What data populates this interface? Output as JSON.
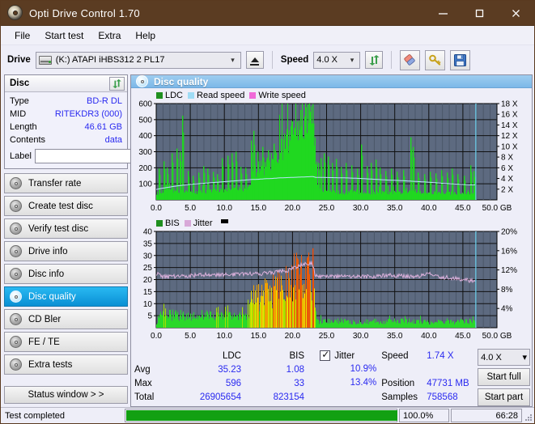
{
  "window": {
    "title": "Opti Drive Control 1.70",
    "icon": "disc-icon",
    "minimize": "–",
    "maximize": "□",
    "close": "✕"
  },
  "menu": {
    "items": [
      "File",
      "Start test",
      "Extra",
      "Help"
    ]
  },
  "toolbar": {
    "drive_label": "Drive",
    "drive_value": "(K:)  ATAPI iHBS312   2 PL17",
    "eject_title": "eject",
    "speed_label": "Speed",
    "speed_value": "4.0 X",
    "refresh_icon": "refresh-icon",
    "erase_icon": "eraser-icon",
    "tools_icon": "keys-icon",
    "save_icon": "floppy-save-icon"
  },
  "disc": {
    "group_title": "Disc",
    "refresh_icon": "refresh-icon",
    "rows": [
      {
        "key": "Type",
        "value": "BD-R DL"
      },
      {
        "key": "MID",
        "value": "RITEKDR3 (000)"
      },
      {
        "key": "Length",
        "value": "46.61 GB"
      },
      {
        "key": "Contents",
        "value": "data"
      }
    ],
    "label_key": "Label",
    "label_value": "",
    "label_placeholder": ""
  },
  "sidebar": {
    "items": [
      {
        "label": "Transfer rate",
        "active": false
      },
      {
        "label": "Create test disc",
        "active": false
      },
      {
        "label": "Verify test disc",
        "active": false
      },
      {
        "label": "Drive info",
        "active": false
      },
      {
        "label": "Disc info",
        "active": false
      },
      {
        "label": "Disc quality",
        "active": true
      },
      {
        "label": "CD Bler",
        "active": false
      },
      {
        "label": "FE / TE",
        "active": false
      },
      {
        "label": "Extra tests",
        "active": false
      }
    ],
    "status_button": "Status window > >"
  },
  "panel": {
    "title": "Disc quality",
    "icon": "disc-quality-icon"
  },
  "stats": {
    "col_ldc": "LDC",
    "col_bis": "BIS",
    "jitter_label": "Jitter",
    "jitter_checked": true,
    "rows": [
      {
        "label": "Avg",
        "ldc": "35.23",
        "bis": "1.08",
        "jitter": "10.9%"
      },
      {
        "label": "Max",
        "ldc": "596",
        "bis": "33",
        "jitter": "13.4%"
      },
      {
        "label": "Total",
        "ldc": "26905654",
        "bis": "823154",
        "jitter": ""
      }
    ],
    "speed_label": "Speed",
    "speed_value": "1.74 X",
    "position_label": "Position",
    "position_value": "47731 MB",
    "samples_label": "Samples",
    "samples_value": "758568",
    "speed_select": "4.0 X",
    "start_full": "Start full",
    "start_part": "Start part"
  },
  "statusbar": {
    "message": "Test completed",
    "progress_percent": 100,
    "progress_text": "100.0%",
    "elapsed": "66:28"
  },
  "colors": {
    "titlebar": "#5b3c22",
    "accent": "#2a2af0",
    "ldc": "#20d820",
    "read_speed": "#9fdcf5",
    "write_speed": "#f06ad8",
    "bis": "#20d820",
    "jitter": "#d8a8d8",
    "plot_bg": "#5d6a80",
    "progress": "#12a012"
  },
  "chart_data": [
    {
      "type": "area",
      "title": "LDC / Read speed",
      "xlabel": "GB",
      "ylabel": "LDC",
      "xlim": [
        0,
        50
      ],
      "ylim": [
        0,
        600
      ],
      "y2lim": [
        0,
        18
      ],
      "y2label": "X",
      "xticks": [
        "0.0",
        "5.0",
        "10.0",
        "15.0",
        "20.0",
        "25.0",
        "30.0",
        "35.0",
        "40.0",
        "45.0",
        "50.0 GB"
      ],
      "yticks": [
        100,
        200,
        300,
        400,
        500,
        600
      ],
      "y2ticks": [
        "2 X",
        "4 X",
        "6 X",
        "8 X",
        "10 X",
        "12 X",
        "14 X",
        "16 X",
        "18 X"
      ],
      "grid": true,
      "legend": [
        {
          "name": "LDC",
          "color": "#1f8f1f"
        },
        {
          "name": "Read speed",
          "color": "#9fdcf5"
        },
        {
          "name": "Write speed",
          "color": "#f06ad8"
        }
      ],
      "data_end_gb": 46.9,
      "series": [
        {
          "name": "LDC",
          "type": "area",
          "color": "#20d820",
          "x": [
            0.0,
            0.5,
            1.0,
            1.5,
            2.0,
            2.5,
            3.0,
            3.5,
            4.0,
            4.5,
            5.0,
            5.5,
            6.0,
            6.5,
            7.0,
            7.5,
            8.0,
            8.5,
            9.0,
            9.5,
            10.0,
            10.5,
            11.0,
            11.5,
            12.0,
            12.5,
            13.0,
            13.5,
            14.0,
            14.5,
            15.0,
            15.5,
            16.0,
            16.5,
            17.0,
            17.5,
            18.0,
            18.5,
            19.0,
            19.5,
            20.0,
            20.5,
            21.0,
            21.5,
            22.0,
            22.5,
            23.0,
            23.3,
            23.6,
            24.0,
            24.5,
            25.0,
            25.5,
            26.0,
            27.0,
            28.0,
            29.0,
            30.0,
            31.0,
            32.0,
            33.0,
            34.0,
            35.0,
            36.0,
            37.0,
            37.5,
            38.0,
            39.0,
            40.0,
            41.0,
            42.0,
            43.0,
            44.0,
            45.0,
            46.0,
            46.9
          ],
          "baseline": [
            40,
            45,
            48,
            50,
            52,
            52,
            55,
            55,
            55,
            52,
            50,
            48,
            48,
            48,
            50,
            52,
            52,
            55,
            55,
            58,
            58,
            60,
            62,
            62,
            65,
            68,
            70,
            80,
            150,
            175,
            185,
            195,
            210,
            225,
            245,
            265,
            290,
            320,
            345,
            375,
            400,
            430,
            455,
            480,
            505,
            540,
            560,
            330,
            110,
            60,
            55,
            50,
            48,
            48,
            45,
            45,
            45,
            45,
            45,
            45,
            45,
            45,
            45,
            45,
            45,
            45,
            45,
            45,
            45,
            42,
            42,
            42,
            42,
            40,
            40,
            38
          ],
          "spikes": [
            {
              "x": 0.3,
              "y": 195
            },
            {
              "x": 1.1,
              "y": 240
            },
            {
              "x": 1.6,
              "y": 200
            },
            {
              "x": 2.2,
              "y": 290
            },
            {
              "x": 3.0,
              "y": 320
            },
            {
              "x": 3.4,
              "y": 300
            },
            {
              "x": 3.8,
              "y": 525
            },
            {
              "x": 4.6,
              "y": 180
            },
            {
              "x": 5.4,
              "y": 150
            },
            {
              "x": 6.2,
              "y": 170
            },
            {
              "x": 6.9,
              "y": 210
            },
            {
              "x": 7.5,
              "y": 195
            },
            {
              "x": 8.3,
              "y": 175
            },
            {
              "x": 8.9,
              "y": 160
            },
            {
              "x": 9.6,
              "y": 260
            },
            {
              "x": 10.4,
              "y": 275
            },
            {
              "x": 11.0,
              "y": 290
            },
            {
              "x": 11.6,
              "y": 300
            },
            {
              "x": 12.3,
              "y": 205
            },
            {
              "x": 13.1,
              "y": 200
            },
            {
              "x": 13.9,
              "y": 370
            },
            {
              "x": 14.3,
              "y": 430
            },
            {
              "x": 14.9,
              "y": 300
            },
            {
              "x": 15.6,
              "y": 330
            },
            {
              "x": 16.4,
              "y": 310
            },
            {
              "x": 17.2,
              "y": 350
            },
            {
              "x": 18.3,
              "y": 380
            },
            {
              "x": 19.1,
              "y": 420
            },
            {
              "x": 20.2,
              "y": 450
            },
            {
              "x": 21.1,
              "y": 560
            },
            {
              "x": 21.7,
              "y": 520
            },
            {
              "x": 22.2,
              "y": 596
            },
            {
              "x": 22.6,
              "y": 545
            },
            {
              "x": 22.9,
              "y": 596
            },
            {
              "x": 23.7,
              "y": 230
            },
            {
              "x": 24.1,
              "y": 260
            },
            {
              "x": 24.6,
              "y": 290
            },
            {
              "x": 25.2,
              "y": 270
            },
            {
              "x": 25.8,
              "y": 230
            },
            {
              "x": 26.4,
              "y": 255
            },
            {
              "x": 27.1,
              "y": 205
            },
            {
              "x": 27.8,
              "y": 230
            },
            {
              "x": 28.6,
              "y": 215
            },
            {
              "x": 29.4,
              "y": 195
            },
            {
              "x": 30.0,
              "y": 345
            },
            {
              "x": 30.9,
              "y": 210
            },
            {
              "x": 31.5,
              "y": 230
            },
            {
              "x": 32.2,
              "y": 250
            },
            {
              "x": 32.8,
              "y": 200
            },
            {
              "x": 33.6,
              "y": 180
            },
            {
              "x": 34.4,
              "y": 195
            },
            {
              "x": 35.3,
              "y": 175
            },
            {
              "x": 36.2,
              "y": 185
            },
            {
              "x": 37.3,
              "y": 390
            },
            {
              "x": 37.6,
              "y": 330
            },
            {
              "x": 38.4,
              "y": 170
            },
            {
              "x": 39.3,
              "y": 160
            },
            {
              "x": 40.2,
              "y": 175
            },
            {
              "x": 41.0,
              "y": 165
            },
            {
              "x": 41.8,
              "y": 185
            },
            {
              "x": 42.6,
              "y": 170
            },
            {
              "x": 43.4,
              "y": 195
            },
            {
              "x": 44.2,
              "y": 160
            },
            {
              "x": 45.1,
              "y": 150
            },
            {
              "x": 46.1,
              "y": 215
            },
            {
              "x": 46.5,
              "y": 180
            }
          ]
        },
        {
          "name": "Read speed",
          "type": "line",
          "color": "#b8e6fa",
          "axis": "y2",
          "x": [
            0.0,
            1.0,
            2.0,
            3.0,
            4.0,
            5.0,
            6.0,
            7.0,
            8.0,
            9.0,
            10.0,
            11.0,
            12.0,
            13.0,
            14.0,
            15.0,
            16.0,
            17.0,
            18.0,
            19.0,
            20.0,
            21.0,
            22.0,
            23.0,
            23.4,
            24.0,
            26.0,
            28.0,
            30.0,
            32.0,
            34.0,
            36.0,
            38.0,
            40.0,
            42.0,
            44.0,
            46.0,
            46.9
          ],
          "values": [
            1.95,
            2.2,
            2.4,
            2.6,
            2.75,
            2.9,
            3.0,
            3.1,
            3.2,
            3.3,
            3.4,
            3.5,
            3.6,
            3.7,
            3.8,
            3.85,
            3.95,
            4.0,
            4.1,
            4.15,
            4.2,
            4.25,
            4.3,
            4.35,
            4.2,
            4.2,
            4.15,
            4.1,
            4.0,
            3.85,
            3.7,
            3.6,
            3.45,
            3.3,
            3.1,
            2.95,
            2.8,
            2.8
          ]
        }
      ],
      "cursor_gb": 46.9
    },
    {
      "type": "area",
      "title": "BIS / Jitter",
      "xlabel": "GB",
      "ylabel": "BIS",
      "xlim": [
        0,
        50
      ],
      "ylim": [
        0,
        40
      ],
      "y2lim": [
        0,
        20
      ],
      "y2label": "%",
      "xticks": [
        "0.0",
        "5.0",
        "10.0",
        "15.0",
        "20.0",
        "25.0",
        "30.0",
        "35.0",
        "40.0",
        "45.0",
        "50.0 GB"
      ],
      "yticks": [
        5,
        10,
        15,
        20,
        25,
        30,
        35,
        40
      ],
      "y2ticks": [
        "4%",
        "8%",
        "12%",
        "16%",
        "20%"
      ],
      "grid": true,
      "legend": [
        {
          "name": "BIS",
          "color": "#1f8f1f"
        },
        {
          "name": "Jitter",
          "color": "#d8a8d8"
        }
      ],
      "data_end_gb": 46.9,
      "series": [
        {
          "name": "BIS",
          "type": "area",
          "color_low": "#20d820",
          "color_mid": "#e8e000",
          "color_high": "#e85800",
          "x": [
            0.0,
            0.5,
            1.0,
            2.0,
            3.0,
            4.0,
            5.0,
            6.0,
            7.0,
            8.0,
            9.0,
            10.0,
            11.0,
            12.0,
            13.0,
            13.6,
            14.0,
            15.0,
            16.0,
            17.0,
            18.0,
            19.0,
            20.0,
            21.0,
            22.0,
            23.0,
            23.2,
            23.5,
            24.0,
            25.0,
            26.0,
            28.0,
            30.0,
            32.0,
            34.0,
            36.0,
            38.0,
            40.0,
            42.0,
            44.0,
            46.0,
            46.9
          ],
          "values": [
            3,
            5,
            6,
            6,
            6,
            6,
            6,
            6,
            6,
            6,
            7,
            7,
            7,
            7,
            7,
            8,
            14,
            15,
            16,
            17,
            19,
            21,
            24,
            25,
            24,
            25,
            20,
            3,
            3,
            3,
            3,
            3,
            3,
            3,
            3,
            3,
            3,
            3,
            3,
            3,
            3,
            3
          ],
          "max_spike": 33
        },
        {
          "name": "Jitter",
          "type": "line",
          "color": "#dbb0db",
          "axis": "y2",
          "x": [
            0.0,
            1.0,
            2.0,
            3.0,
            4.0,
            5.0,
            6.0,
            7.0,
            8.0,
            9.0,
            10.0,
            11.0,
            12.0,
            13.0,
            14.0,
            15.0,
            16.0,
            17.0,
            18.0,
            19.0,
            20.0,
            20.5,
            21.0,
            21.5,
            22.0,
            22.6,
            23.0,
            23.3,
            24.0,
            26.0,
            28.0,
            30.0,
            32.0,
            34.0,
            36.0,
            38.0,
            40.0,
            41.0,
            42.0,
            43.0,
            44.0,
            45.0,
            46.0,
            46.9
          ],
          "values": [
            11.3,
            10.6,
            10.6,
            10.7,
            10.7,
            10.8,
            11.0,
            11.0,
            11.0,
            11.0,
            11.0,
            11.0,
            11.1,
            11.1,
            11.2,
            11.2,
            11.3,
            11.4,
            11.6,
            11.8,
            12.2,
            12.6,
            13.0,
            13.2,
            13.3,
            13.4,
            13.2,
            10.8,
            10.7,
            10.6,
            10.6,
            10.6,
            10.7,
            10.9,
            10.8,
            10.6,
            11.2,
            10.9,
            10.5,
            10.4,
            10.2,
            10.0,
            9.8,
            9.8
          ]
        }
      ],
      "cursor_gb": 46.9
    }
  ]
}
